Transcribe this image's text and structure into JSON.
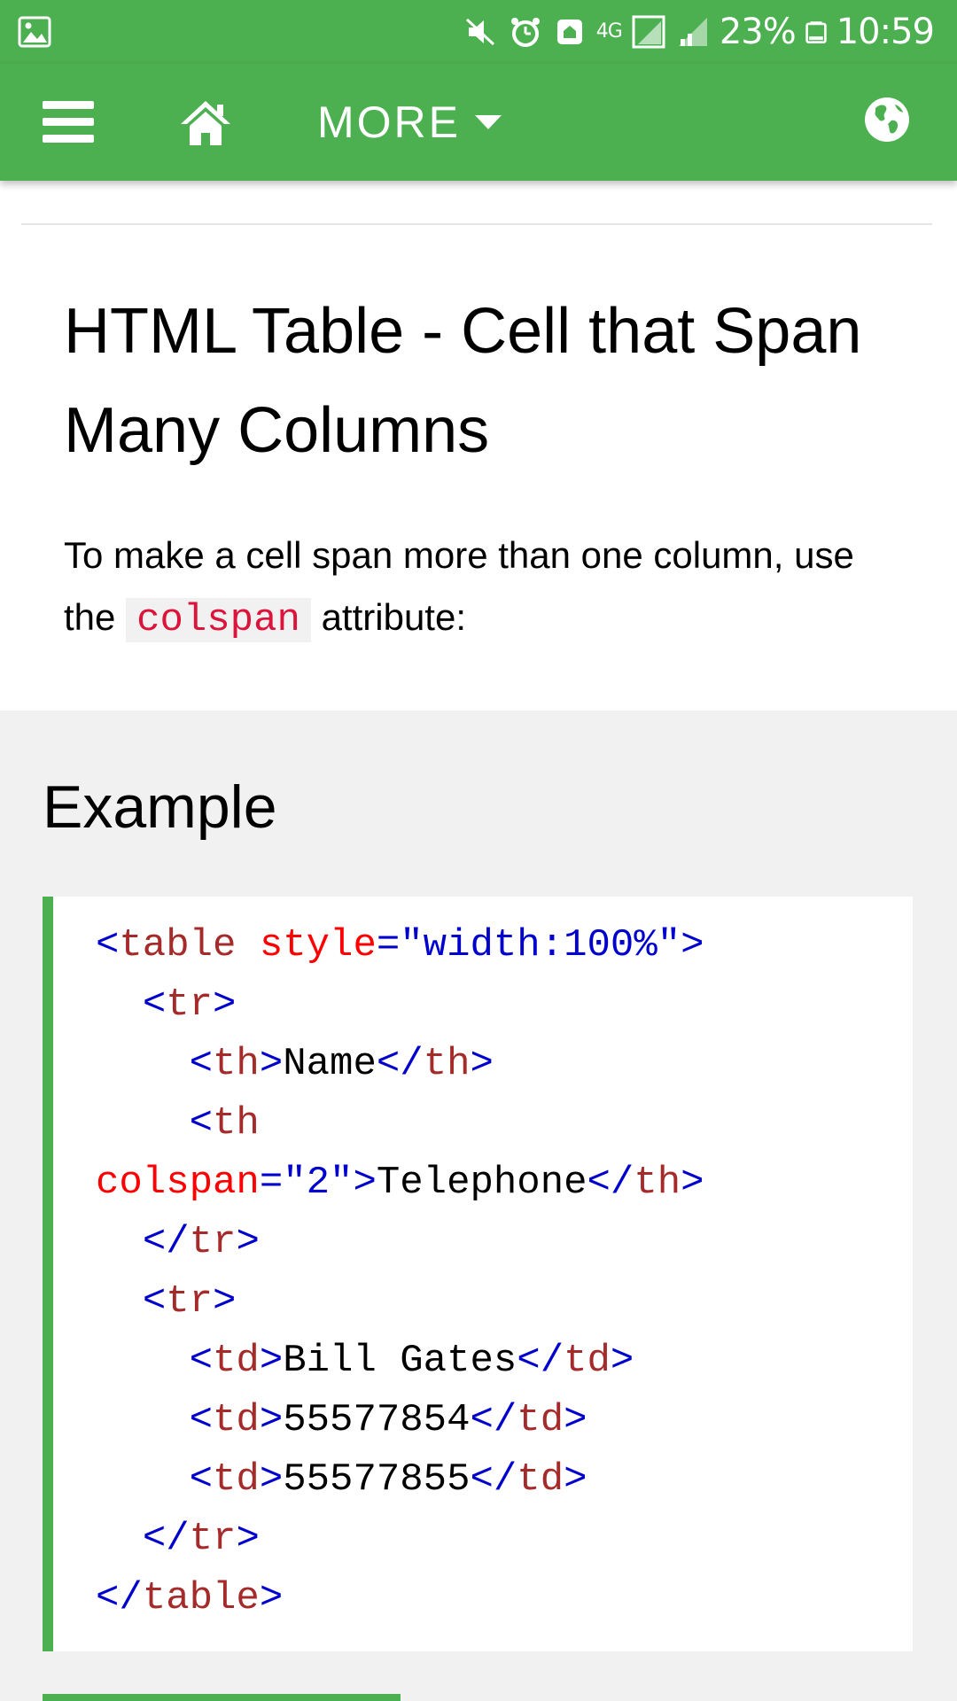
{
  "status_bar": {
    "battery": "23%",
    "time": "10:59",
    "network": "4G"
  },
  "nav": {
    "more_label": "MORE"
  },
  "page": {
    "title": "HTML Table - Cell that Span Many Columns",
    "intro_before": "To make a cell span more than one column, use the ",
    "intro_code": "colspan",
    "intro_after": " attribute:"
  },
  "example": {
    "heading": "Example",
    "code_lines": [
      [
        [
          "br",
          "<"
        ],
        [
          "tag",
          "table"
        ],
        [
          "txt",
          " "
        ],
        [
          "attr",
          "style"
        ],
        [
          "br",
          "="
        ],
        [
          "val",
          "\"width:100%\""
        ],
        [
          "br",
          ">"
        ]
      ],
      [
        [
          "txt",
          "  "
        ],
        [
          "br",
          "<"
        ],
        [
          "tag",
          "tr"
        ],
        [
          "br",
          ">"
        ]
      ],
      [
        [
          "txt",
          "    "
        ],
        [
          "br",
          "<"
        ],
        [
          "tag",
          "th"
        ],
        [
          "br",
          ">"
        ],
        [
          "txt",
          "Name"
        ],
        [
          "br",
          "</"
        ],
        [
          "tag",
          "th"
        ],
        [
          "br",
          ">"
        ]
      ],
      [
        [
          "txt",
          "    "
        ],
        [
          "br",
          "<"
        ],
        [
          "tag",
          "th"
        ]
      ],
      [
        [
          "attr",
          "colspan"
        ],
        [
          "br",
          "="
        ],
        [
          "val",
          "\"2\""
        ],
        [
          "br",
          ">"
        ],
        [
          "txt",
          "Telephone"
        ],
        [
          "br",
          "</"
        ],
        [
          "tag",
          "th"
        ],
        [
          "br",
          ">"
        ]
      ],
      [
        [
          "txt",
          "  "
        ],
        [
          "br",
          "</"
        ],
        [
          "tag",
          "tr"
        ],
        [
          "br",
          ">"
        ]
      ],
      [
        [
          "txt",
          "  "
        ],
        [
          "br",
          "<"
        ],
        [
          "tag",
          "tr"
        ],
        [
          "br",
          ">"
        ]
      ],
      [
        [
          "txt",
          "    "
        ],
        [
          "br",
          "<"
        ],
        [
          "tag",
          "td"
        ],
        [
          "br",
          ">"
        ],
        [
          "txt",
          "Bill Gates"
        ],
        [
          "br",
          "</"
        ],
        [
          "tag",
          "td"
        ],
        [
          "br",
          ">"
        ]
      ],
      [
        [
          "txt",
          "    "
        ],
        [
          "br",
          "<"
        ],
        [
          "tag",
          "td"
        ],
        [
          "br",
          ">"
        ],
        [
          "txt",
          "55577854"
        ],
        [
          "br",
          "</"
        ],
        [
          "tag",
          "td"
        ],
        [
          "br",
          ">"
        ]
      ],
      [
        [
          "txt",
          "    "
        ],
        [
          "br",
          "<"
        ],
        [
          "tag",
          "td"
        ],
        [
          "br",
          ">"
        ],
        [
          "txt",
          "55577855"
        ],
        [
          "br",
          "</"
        ],
        [
          "tag",
          "td"
        ],
        [
          "br",
          ">"
        ]
      ],
      [
        [
          "txt",
          "  "
        ],
        [
          "br",
          "</"
        ],
        [
          "tag",
          "tr"
        ],
        [
          "br",
          ">"
        ]
      ],
      [
        [
          "br",
          "</"
        ],
        [
          "tag",
          "table"
        ],
        [
          "br",
          ">"
        ]
      ]
    ]
  },
  "colors": {
    "brand_green": "#4caf50",
    "code_bracket": "#0000cd",
    "code_tag": "#a52a2a",
    "code_attr": "#ff0000",
    "code_value": "#0000cd",
    "inline_code": "#dc143c"
  }
}
